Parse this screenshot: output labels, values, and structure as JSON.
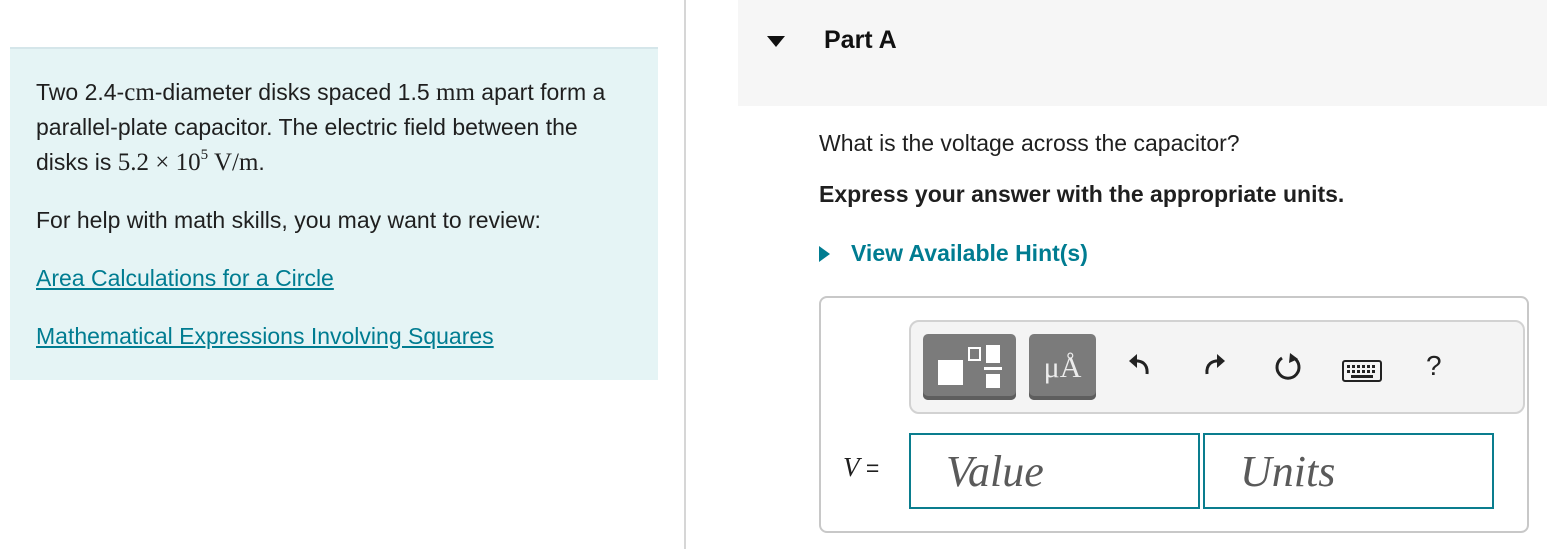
{
  "problem": {
    "text_part1": "Two 2.4-",
    "cm": "cm",
    "text_part2": "-diameter disks spaced 1.5 ",
    "mm": "mm",
    "text_part3": " apart form a parallel-plate capacitor. The electric field between the disks is ",
    "field_mantissa": "5.2 × 10",
    "field_exponent": "5",
    "field_units": " V/m",
    "period": ".",
    "review_prompt": "For help with math skills, you may want to review:",
    "links": [
      "Area Calculations for a Circle",
      "Mathematical Expressions Involving Squares"
    ]
  },
  "part": {
    "title": "Part A",
    "question": "What is the voltage across the capacitor?",
    "instruction": "Express your answer with the appropriate units.",
    "hint_label": "View Available Hint(s)"
  },
  "answer": {
    "toolbar": {
      "units_glyph": "μÅ",
      "help_glyph": "?",
      "icons": [
        "template-icon",
        "units-icon",
        "undo-icon",
        "redo-icon",
        "reset-icon",
        "keyboard-icon",
        "help-icon"
      ]
    },
    "variable": "V",
    "equals": " =",
    "value_placeholder": "Value",
    "units_placeholder": "Units"
  },
  "colors": {
    "link": "#007c91",
    "panel_bg": "#e5f4f5",
    "input_border": "#0a7d8e",
    "toolbar_button": "#7b7b7b"
  }
}
